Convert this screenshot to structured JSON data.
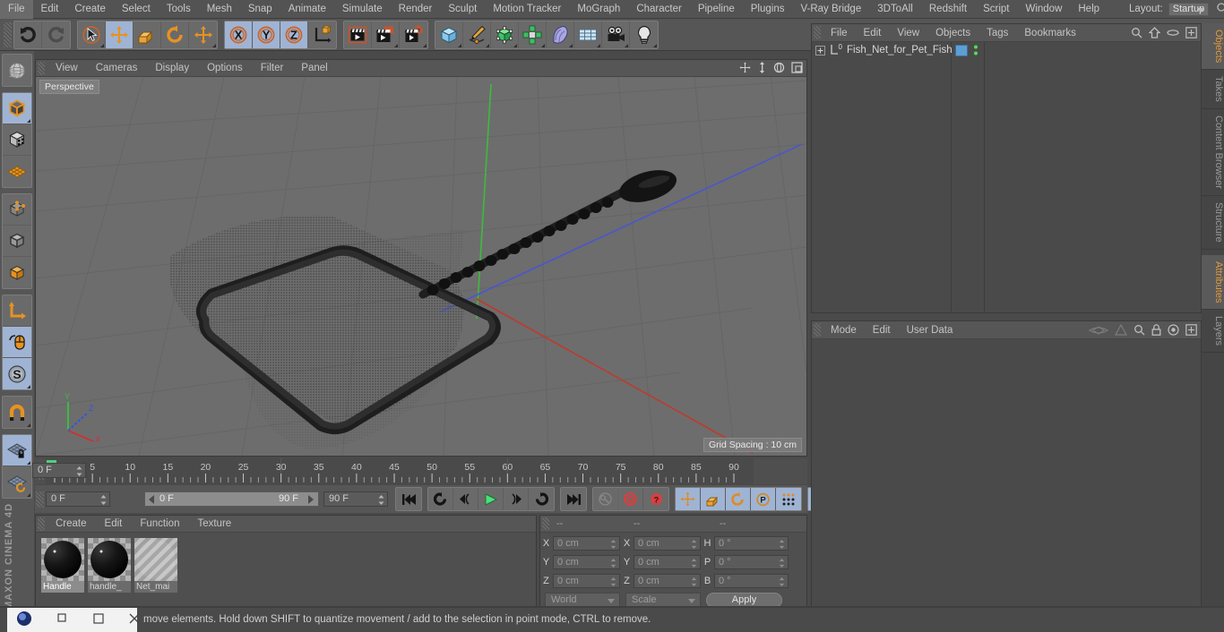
{
  "app": {
    "title": "CINEMA 4D",
    "brand": "MAXON CINEMA 4D"
  },
  "menubar": {
    "items": [
      "File",
      "Edit",
      "Create",
      "Select",
      "Tools",
      "Mesh",
      "Snap",
      "Animate",
      "Simulate",
      "Render",
      "Sculpt",
      "Motion Tracker",
      "MoGraph",
      "Character",
      "Pipeline",
      "Plugins",
      "V-Ray Bridge",
      "3DToAll",
      "Redshift",
      "Script",
      "Window",
      "Help"
    ],
    "layout_label": "Layout:",
    "layout_value": "Startup",
    "search_icon": "search-icon"
  },
  "toolbar": {
    "groups": [
      {
        "name": "undo-redo",
        "buttons": [
          {
            "name": "undo-button",
            "icon": "undo-arrow-icon",
            "selected": false,
            "disabled": false,
            "corner": false
          },
          {
            "name": "redo-button",
            "icon": "redo-arrow-icon",
            "selected": false,
            "disabled": true,
            "corner": false
          }
        ]
      },
      {
        "name": "transform-tools",
        "buttons": [
          {
            "name": "live-selection-tool",
            "icon": "cursor-circle-icon",
            "selected": false,
            "disabled": false,
            "corner": true
          },
          {
            "name": "move-tool",
            "icon": "move-arrows-icon",
            "selected": true,
            "disabled": false,
            "corner": false
          },
          {
            "name": "scale-tool",
            "icon": "scale-box-icon",
            "selected": false,
            "disabled": false,
            "corner": false
          },
          {
            "name": "rotate-tool",
            "icon": "rotate-arc-icon",
            "selected": false,
            "disabled": false,
            "corner": false
          },
          {
            "name": "move-duplicate-tool",
            "icon": "move-arrows-icon",
            "selected": false,
            "disabled": false,
            "corner": true
          }
        ]
      },
      {
        "name": "axis-locks",
        "buttons": [
          {
            "name": "lock-x-axis-button",
            "icon": "x-axis-icon",
            "label": "X",
            "selected": true,
            "disabled": false,
            "corner": false
          },
          {
            "name": "lock-y-axis-button",
            "icon": "y-axis-icon",
            "label": "Y",
            "selected": true,
            "disabled": false,
            "corner": false
          },
          {
            "name": "lock-z-axis-button",
            "icon": "z-axis-icon",
            "label": "Z",
            "selected": true,
            "disabled": false,
            "corner": false
          },
          {
            "name": "world-object-coordinates-button",
            "icon": "world-axis-cube-icon",
            "selected": false,
            "disabled": false,
            "corner": false
          }
        ]
      },
      {
        "name": "render-tools",
        "buttons": [
          {
            "name": "render-view-button",
            "icon": "clapperboard-region-icon",
            "selected": false,
            "disabled": false,
            "corner": false
          },
          {
            "name": "render-to-picture-viewer-button",
            "icon": "clapperboard-picture-icon",
            "selected": false,
            "disabled": false,
            "corner": true
          },
          {
            "name": "render-settings-button",
            "icon": "clapperboard-gear-icon",
            "selected": false,
            "disabled": false,
            "corner": true
          }
        ]
      },
      {
        "name": "object-creation",
        "buttons": [
          {
            "name": "add-cube-button",
            "icon": "blue-cube-icon",
            "selected": false,
            "disabled": false,
            "corner": true
          },
          {
            "name": "add-spline-button",
            "icon": "pen-spline-icon",
            "selected": false,
            "disabled": false,
            "corner": true
          },
          {
            "name": "add-generator-button",
            "icon": "green-cube-nurbs-icon",
            "selected": false,
            "disabled": false,
            "corner": true
          },
          {
            "name": "add-array-button",
            "icon": "green-cluster-icon",
            "selected": false,
            "disabled": false,
            "corner": true
          },
          {
            "name": "add-deformer-button",
            "icon": "bend-deformer-icon",
            "selected": false,
            "disabled": false,
            "corner": true
          },
          {
            "name": "add-environment-button",
            "icon": "floor-grid-icon",
            "selected": false,
            "disabled": false,
            "corner": true
          },
          {
            "name": "add-camera-button",
            "icon": "camera-icon",
            "selected": false,
            "disabled": false,
            "corner": true
          },
          {
            "name": "add-light-button",
            "icon": "lightbulb-icon",
            "selected": false,
            "disabled": false,
            "corner": true
          }
        ]
      }
    ]
  },
  "left_toolbar": {
    "groups": [
      {
        "name": "viewport-layout",
        "buttons": [
          {
            "name": "undo-view-button",
            "icon": "globe-grid-icon",
            "selected": false,
            "corner": false
          }
        ]
      },
      {
        "name": "editor-modes",
        "buttons": [
          {
            "name": "make-editable-button",
            "icon": "orange-outlined-cube-icon",
            "selected": true,
            "corner": true
          },
          {
            "name": "texture-axis-mode-button",
            "icon": "checker-cube-icon",
            "selected": false,
            "corner": false
          },
          {
            "name": "viewport-solo-button",
            "icon": "orange-grid-plane-icon",
            "selected": false,
            "corner": false
          }
        ]
      },
      {
        "name": "component-modes",
        "buttons": [
          {
            "name": "points-mode-button",
            "icon": "cube-points-icon",
            "selected": false,
            "corner": false
          },
          {
            "name": "edges-mode-button",
            "icon": "cube-edges-icon",
            "selected": false,
            "corner": false
          },
          {
            "name": "polygons-mode-button",
            "icon": "cube-polygons-icon",
            "selected": false,
            "corner": false
          }
        ]
      },
      {
        "name": "axis-snap-modes",
        "buttons": [
          {
            "name": "enable-axis-modification-button",
            "icon": "axis-L-icon",
            "selected": false,
            "corner": false
          },
          {
            "name": "enable-snapping-button",
            "icon": "mouse-icon",
            "selected": true,
            "corner": false
          },
          {
            "name": "soft-selection-button",
            "icon": "s-circle-icon",
            "selected": true,
            "corner": true
          }
        ]
      },
      {
        "name": "magnet",
        "buttons": [
          {
            "name": "magnet-tool-button",
            "icon": "magnet-icon",
            "selected": false,
            "corner": true
          }
        ]
      },
      {
        "name": "workplane",
        "buttons": [
          {
            "name": "lock-workplane-button",
            "icon": "workplane-lock-icon",
            "selected": true,
            "corner": true
          },
          {
            "name": "align-workplane-button",
            "icon": "workplane-rotate-icon",
            "selected": false,
            "corner": true
          }
        ]
      }
    ]
  },
  "viewport": {
    "menu": [
      "View",
      "Cameras",
      "Display",
      "Options",
      "Filter",
      "Panel"
    ],
    "label": "Perspective",
    "grid_spacing": "Grid Spacing : 10 cm",
    "nav_icons": [
      "pan-icon",
      "dolly-icon",
      "orbit-icon",
      "maximize-icon"
    ],
    "axis_gizmo": {
      "x": "X",
      "y": "Y",
      "z": "Z",
      "x_color": "#cc3333",
      "y_color": "#33bb33",
      "z_color": "#3355dd"
    },
    "scene_object": "fish net model",
    "background_color": "#6d6d6d",
    "axis_lines": {
      "x": "#a8504f",
      "y": "#4faa4f",
      "z": "#4f4faa"
    }
  },
  "timeline": {
    "start": 0,
    "end": 90,
    "major_ticks": [
      0,
      5,
      10,
      15,
      20,
      25,
      30,
      35,
      40,
      45,
      50,
      55,
      60,
      65,
      70,
      75,
      80,
      85,
      90
    ],
    "current_frame_label": "0 F",
    "playhead_frame": 0,
    "playhead_color": "#4fd07a"
  },
  "transport": {
    "current_frame": "0 F",
    "range_start": "0 F",
    "range_end": "90 F",
    "max_frame": "90 F",
    "buttons": [
      {
        "name": "go-to-start-button",
        "icon": "skip-start-icon"
      },
      {
        "name": "play-reverse-loop-button",
        "icon": "loop-reverse-icon"
      },
      {
        "name": "previous-frame-button",
        "icon": "step-back-icon"
      },
      {
        "name": "play-button",
        "icon": "play-icon"
      },
      {
        "name": "next-frame-button",
        "icon": "step-forward-icon"
      },
      {
        "name": "play-forward-loop-button",
        "icon": "loop-forward-icon"
      },
      {
        "name": "go-to-end-button",
        "icon": "skip-end-icon"
      },
      {
        "name": "record-active-objects-button",
        "icon": "key-icon"
      },
      {
        "name": "autokeying-button",
        "icon": "red-circle-icon"
      },
      {
        "name": "keyframe-selection-button",
        "icon": "red-question-icon"
      },
      {
        "name": "position-key-button",
        "icon": "move-arrows-icon"
      },
      {
        "name": "scale-key-button",
        "icon": "scale-box-icon"
      },
      {
        "name": "rotation-key-button",
        "icon": "rotate-arc-icon"
      },
      {
        "name": "parameter-key-button",
        "icon": "p-circle-icon"
      },
      {
        "name": "point-level-animation-button",
        "icon": "dots-grid-icon"
      },
      {
        "name": "timeline-toggle-button",
        "icon": "filmstrip-icon"
      }
    ]
  },
  "material_manager": {
    "menu": [
      "Create",
      "Edit",
      "Function",
      "Texture"
    ],
    "materials": [
      {
        "name": "Handle",
        "type": "solid-dark",
        "active": true
      },
      {
        "name": "handle_",
        "type": "solid-dark",
        "active": false
      },
      {
        "name": "Net_mai",
        "type": "transparent-diagonal",
        "active": false
      }
    ]
  },
  "coordinates": {
    "headers": [
      "--",
      "--",
      "--"
    ],
    "rows": [
      {
        "pos_label": "X",
        "pos_value": "0 cm",
        "size_label": "X",
        "size_value": "0 cm",
        "rot_label": "H",
        "rot_value": "0 °"
      },
      {
        "pos_label": "Y",
        "pos_value": "0 cm",
        "size_label": "Y",
        "size_value": "0 cm",
        "rot_label": "P",
        "rot_value": "0 °"
      },
      {
        "pos_label": "Z",
        "pos_value": "0 cm",
        "size_label": "Z",
        "size_value": "0 cm",
        "rot_label": "B",
        "rot_value": "0 °"
      }
    ],
    "system_dropdown": "World",
    "mode_dropdown": "Scale",
    "apply_label": "Apply"
  },
  "object_manager": {
    "menu": [
      "File",
      "Edit",
      "View",
      "Objects",
      "Tags",
      "Bookmarks"
    ],
    "header_icons": [
      "search-icon",
      "home-icon",
      "ellipse-icon",
      "plus-box-icon"
    ],
    "objects": [
      {
        "name": "Fish_Net_for_Pet_Fish",
        "expandable": true,
        "layer_badge": "0",
        "tag_color": "#5d9fd4",
        "has_dots": true
      }
    ]
  },
  "attribute_manager": {
    "menu": [
      "Mode",
      "Edit",
      "User Data"
    ],
    "header_icons": [
      "eye-icon",
      "cone-icon",
      "search-icon",
      "lock-icon",
      "target-icon",
      "plus-box-icon"
    ]
  },
  "right_tabs": {
    "top": [
      {
        "label": "Objects",
        "active": true
      },
      {
        "label": "Takes",
        "active": false
      },
      {
        "label": "Content Browser",
        "active": false
      },
      {
        "label": "Structure",
        "active": false
      }
    ],
    "bottom": [
      {
        "label": "Attributes",
        "active": true
      },
      {
        "label": "Layers",
        "active": false
      }
    ]
  },
  "status_bar": {
    "message": "move elements. Hold down SHIFT to quantize movement / add to the selection in point mode, CTRL to remove.",
    "window_controls": [
      "minimize",
      "maximize",
      "close"
    ]
  }
}
